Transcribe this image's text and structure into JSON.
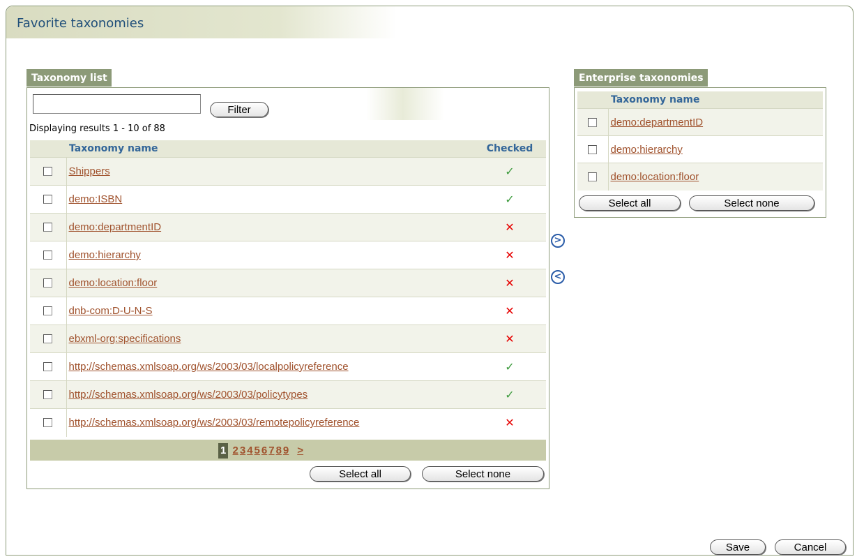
{
  "page": {
    "title": "Favorite taxonomies"
  },
  "taxonomy_list": {
    "label": "Taxonomy list",
    "filter_value": "",
    "filter_button": "Filter",
    "results_text": "Displaying results 1 - 10 of 88",
    "columns": {
      "name": "Taxonomy name",
      "checked": "Checked"
    },
    "rows": [
      {
        "name": "Shippers",
        "checked": true
      },
      {
        "name": "demo:ISBN",
        "checked": true
      },
      {
        "name": "demo:departmentID",
        "checked": false
      },
      {
        "name": "demo:hierarchy",
        "checked": false
      },
      {
        "name": "demo:location:floor",
        "checked": false
      },
      {
        "name": "dnb-com:D-U-N-S",
        "checked": false
      },
      {
        "name": "ebxml-org:specifications",
        "checked": false
      },
      {
        "name": "http://schemas.xmlsoap.org/ws/2003/03/localpolicyreference",
        "checked": true
      },
      {
        "name": "http://schemas.xmlsoap.org/ws/2003/03/policytypes",
        "checked": true
      },
      {
        "name": "http://schemas.xmlsoap.org/ws/2003/03/remotepolicyreference",
        "checked": false
      }
    ],
    "pager": {
      "current": "1",
      "pages": [
        "2",
        "3",
        "4",
        "5",
        "6",
        "7",
        "8",
        "9"
      ],
      "next": ">"
    },
    "select_all": "Select all",
    "select_none": "Select none"
  },
  "move": {
    "right_label": ">",
    "left_label": "<"
  },
  "enterprise": {
    "label": "Enterprise taxonomies",
    "column": "Taxonomy name",
    "rows": [
      "demo:departmentID",
      "demo:hierarchy",
      "demo:location:floor"
    ],
    "select_all": "Select all",
    "select_none": "Select none"
  },
  "footer": {
    "save": "Save",
    "cancel": "Cancel"
  },
  "colors": {
    "accent": "#8c9a78",
    "link": "#a0522d",
    "heading": "#336699",
    "check": "#3b9a3b",
    "cross": "#e60000"
  },
  "icons": {
    "checked": "check-icon",
    "unchecked": "cross-icon"
  }
}
